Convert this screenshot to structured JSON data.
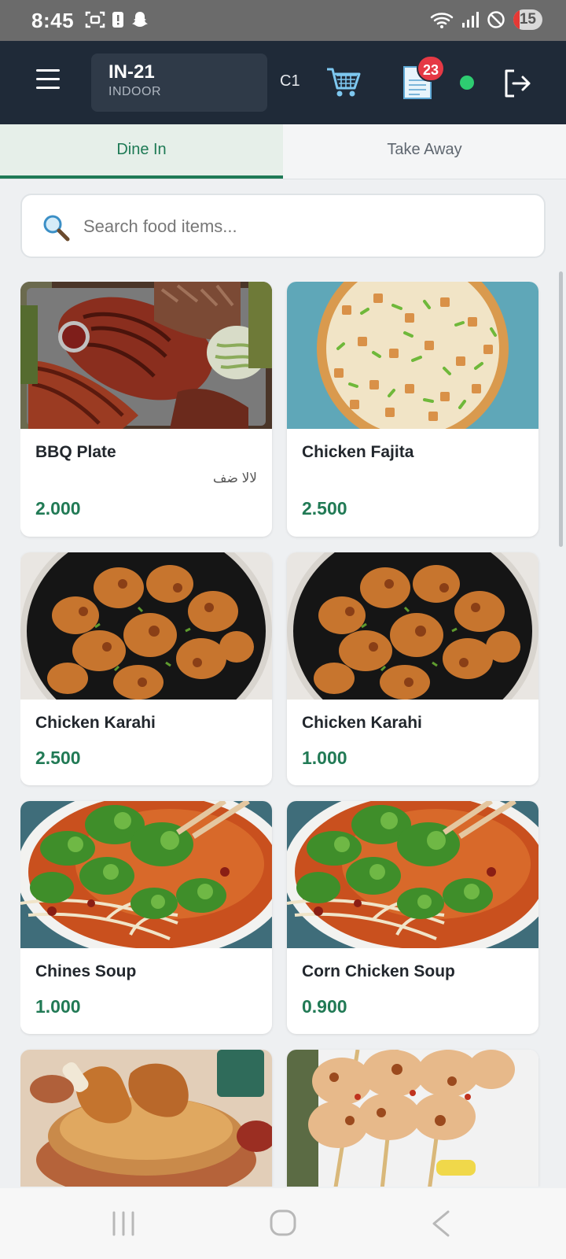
{
  "status_bar": {
    "time": "8:45",
    "battery": "15",
    "icons_left": [
      "screenshot-icon",
      "alert-icon",
      "snapchat-icon"
    ],
    "icons_right": [
      "wifi-icon",
      "signal-icon",
      "do-not-disturb-icon",
      "battery-icon"
    ]
  },
  "header": {
    "table_code": "IN-21",
    "table_area": "INDOOR",
    "counter_code": "C1",
    "orders_badge": "23",
    "connection_color": "#2ecc71"
  },
  "tabs": [
    {
      "label": "Dine In",
      "active": true
    },
    {
      "label": "Take Away",
      "active": false
    }
  ],
  "search": {
    "placeholder": "Search food items..."
  },
  "items": [
    {
      "name": "BBQ Plate",
      "alt_name": "لالا ضف",
      "price": "2.000",
      "image": "bbq-platter"
    },
    {
      "name": "Chicken Fajita",
      "alt_name": "",
      "price": "2.500",
      "image": "pizza"
    },
    {
      "name": "Chicken Karahi",
      "alt_name": "",
      "price": "2.500",
      "image": "karahi"
    },
    {
      "name": "Chicken Karahi",
      "alt_name": "",
      "price": "1.000",
      "image": "karahi"
    },
    {
      "name": "Chines Soup",
      "alt_name": "",
      "price": "1.000",
      "image": "soup"
    },
    {
      "name": "Corn Chicken Soup",
      "alt_name": "",
      "price": "0.900",
      "image": "soup"
    },
    {
      "name": "",
      "alt_name": "",
      "price": "",
      "image": "biryani"
    },
    {
      "name": "",
      "alt_name": "",
      "price": "",
      "image": "skewers"
    }
  ],
  "colors": {
    "header_bg": "#1f2a38",
    "accent_green": "#1e7a55",
    "badge_red": "#e53945"
  }
}
